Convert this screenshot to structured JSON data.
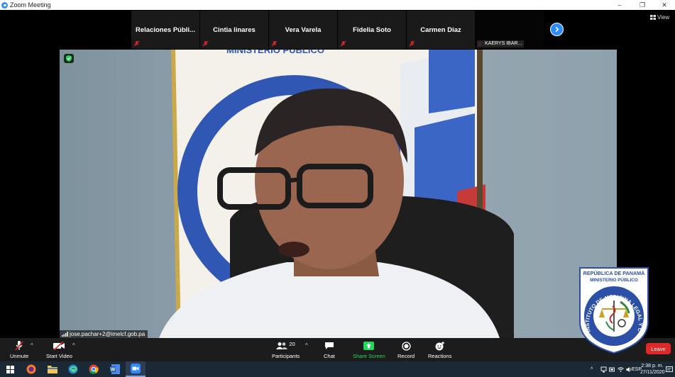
{
  "window": {
    "title": "Zoom Meeting",
    "controls": {
      "minimize": "–",
      "restore": "❐",
      "close": "✕"
    }
  },
  "participants_strip": {
    "tiles": [
      {
        "name": "Relaciones  Públi...",
        "muted": true
      },
      {
        "name": "Cintia linares",
        "muted": true
      },
      {
        "name": "Vera Varela",
        "muted": true
      },
      {
        "name": "Fidelia Soto",
        "muted": true
      },
      {
        "name": "Carmen Diaz",
        "muted": true
      },
      {
        "name": "KAERYS IBAR...",
        "muted": true,
        "video_tile": true
      }
    ],
    "view_label": "View"
  },
  "main_video": {
    "speaker_label": "jose.pachar+2@imelcf.gob.pa",
    "background_text": {
      "banner_top": "MINISTERIO PUBLICO",
      "seal_ring": "INSTITUTO DE MEDICINA LEGAL Y CIENCIAS"
    }
  },
  "toolbar": {
    "unmute": "Unmute",
    "start_video": "Start Video",
    "participants": "Participants",
    "participants_count": "20",
    "chat": "Chat",
    "share_screen": "Share Screen",
    "record": "Record",
    "reactions": "Reactions",
    "leave": "Leave",
    "share_color": "#23d959",
    "leave_color": "#e02828"
  },
  "logo": {
    "line1": "REPÚBLICA DE PANAMÁ",
    "line2": "MINISTERIO PÚBLICO",
    "ring": "INSTITUTO DE MEDICINA LEGAL Y CIENCIAS FORENSES"
  },
  "taskbar": {
    "apps": [
      "windows-start-icon",
      "firefox-icon",
      "file-explorer-icon",
      "edge-icon",
      "chrome-icon",
      "word-icon",
      "zoom-icon"
    ],
    "language": "ESP",
    "time": "2:38 p. m.",
    "date": "27/11/2020"
  }
}
